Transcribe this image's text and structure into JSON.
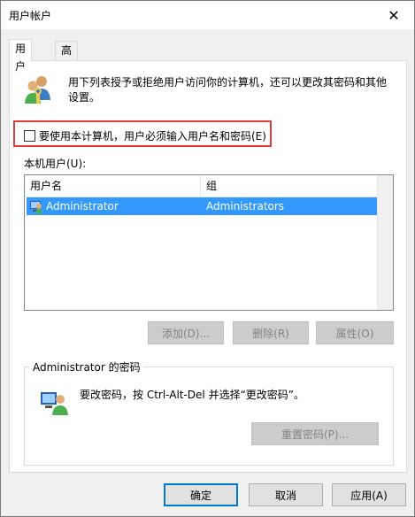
{
  "window": {
    "title": "用户帐户",
    "close_glyph": "✕"
  },
  "tabs": [
    {
      "label": "用户",
      "active": true
    },
    {
      "label": "高级",
      "active": false
    }
  ],
  "intro": {
    "text": "用下列表授予或拒绝用户访问你的计算机，还可以更改其密码和其他设置。",
    "icon": "users-icon"
  },
  "checkbox": {
    "label": "要使用本计算机，用户必须输入用户名和密码(E)",
    "checked": false,
    "highlight_color": "#e23b3b"
  },
  "users_list": {
    "label": "本机用户(U):",
    "columns": [
      "用户名",
      "组"
    ],
    "rows": [
      {
        "username": "Administrator",
        "group": "Administrators",
        "selected": true
      }
    ],
    "selection_color": "#3399ff"
  },
  "list_buttons": {
    "add": "添加(D)...",
    "remove": "删除(R)",
    "properties": "属性(O)"
  },
  "password_group": {
    "title": "Administrator 的密码",
    "text": "要改密码，按 Ctrl-Alt-Del 并选择“更改密码”。",
    "reset_button": "重置密码(P)..."
  },
  "footer_buttons": {
    "ok": "确定",
    "cancel": "取消",
    "apply": "应用(A)"
  },
  "colors": {
    "accent": "#0078d7",
    "panel_bg": "#ffffff",
    "window_bg": "#f0f0f0"
  }
}
